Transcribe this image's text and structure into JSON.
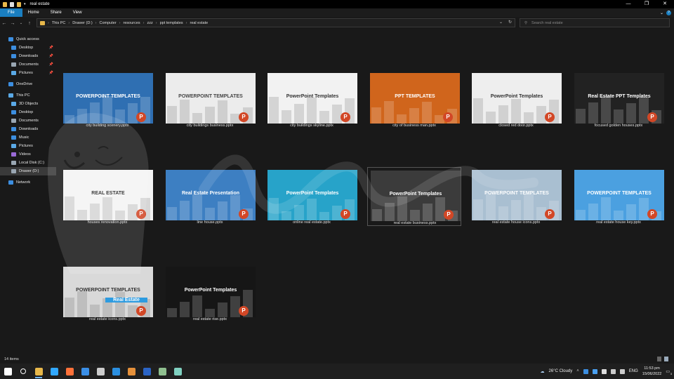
{
  "window": {
    "title": "real estate",
    "controls": [
      "—",
      "❐",
      "✕"
    ]
  },
  "ribbon": {
    "tabs": [
      "File",
      "Home",
      "Share",
      "View"
    ]
  },
  "address": {
    "crumbs": [
      "This PC",
      "Drawer (D:)",
      "Computer",
      "resources",
      "zzz",
      "ppt templates",
      "real estate"
    ],
    "search_placeholder": "Search real estate"
  },
  "sidebar": {
    "items": [
      {
        "label": "Quick access",
        "icon": "star-icon",
        "color": "#3c8ee0",
        "sub": false
      },
      {
        "label": "Desktop",
        "icon": "desktop-icon",
        "color": "#3c8ee0",
        "sub": true,
        "pinned": true
      },
      {
        "label": "Downloads",
        "icon": "download-icon",
        "color": "#3c8ee0",
        "sub": true,
        "pinned": true
      },
      {
        "label": "Documents",
        "icon": "documents-icon",
        "color": "#9aa7b3",
        "sub": true,
        "pinned": true
      },
      {
        "label": "Pictures",
        "icon": "pictures-icon",
        "color": "#5aa9e6",
        "sub": true,
        "pinned": true
      },
      {
        "label": "OneDrive",
        "icon": "cloud-icon",
        "color": "#3c8ee0",
        "sub": false,
        "gap": true
      },
      {
        "label": "This PC",
        "icon": "computer-icon",
        "color": "#5aa9e6",
        "sub": false,
        "gap": true
      },
      {
        "label": "3D Objects",
        "icon": "cube-icon",
        "color": "#5aa9e6",
        "sub": true
      },
      {
        "label": "Desktop",
        "icon": "desktop-icon",
        "color": "#3c8ee0",
        "sub": true
      },
      {
        "label": "Documents",
        "icon": "documents-icon",
        "color": "#9aa7b3",
        "sub": true
      },
      {
        "label": "Downloads",
        "icon": "download-icon",
        "color": "#3c8ee0",
        "sub": true
      },
      {
        "label": "Music",
        "icon": "music-icon",
        "color": "#3c8ee0",
        "sub": true
      },
      {
        "label": "Pictures",
        "icon": "pictures-icon",
        "color": "#5aa9e6",
        "sub": true
      },
      {
        "label": "Videos",
        "icon": "videos-icon",
        "color": "#9a6ad6",
        "sub": true
      },
      {
        "label": "Local Disk (C:)",
        "icon": "drive-icon",
        "color": "#9aa7b3",
        "sub": true
      },
      {
        "label": "Drawer (D:)",
        "icon": "drive-icon",
        "color": "#9aa7b3",
        "sub": true,
        "selected": true
      },
      {
        "label": "Network",
        "icon": "network-icon",
        "color": "#3c8ee0",
        "sub": false,
        "gap": true
      }
    ]
  },
  "files": [
    {
      "name": "city building scenery.pptx",
      "bg": "#2f6fb2",
      "accent": "#ffffff",
      "label": "POWERPOINT TEMPLATES"
    },
    {
      "name": "city buildings business.pptx",
      "bg": "#ececec",
      "accent": "#444444",
      "label": "POWERPOINT TEMPLATES"
    },
    {
      "name": "city buildings skyline.pptx",
      "bg": "#f2f2f2",
      "accent": "#333333",
      "label": "PowerPoint Templates"
    },
    {
      "name": "city of business man.pptx",
      "bg": "#d0651c",
      "accent": "#ffffff",
      "label": "PPT TEMPLATES"
    },
    {
      "name": "closed red door.pptx",
      "bg": "#eeeeee",
      "accent": "#333333",
      "label": "PowerPoint Templates"
    },
    {
      "name": "focused golden houses.pptx",
      "bg": "#222222",
      "accent": "#ffffff",
      "label": "Real Estate PPT Templates"
    },
    {
      "name": "houses renovation.pptx",
      "bg": "#f4f4f4",
      "accent": "#222222",
      "label": "REAL ESTATE"
    },
    {
      "name": "line house.pptx",
      "bg": "#3d7fc2",
      "accent": "#ffffff",
      "label": "Real Estate Presentation"
    },
    {
      "name": "online real estate.pptx",
      "bg": "#27a3c9",
      "accent": "#ffffff",
      "label": "PowerPoint Templates"
    },
    {
      "name": "real estate business.pptx",
      "bg": "#3b3b3b",
      "accent": "#ffffff",
      "label": "PowerPoint Templates",
      "selected": true
    },
    {
      "name": "real estate house icons.pptx",
      "bg": "#a9bfd1",
      "accent": "#ffffff",
      "label": "POWERPOINT TEMPLATES"
    },
    {
      "name": "real estate house key.pptx",
      "bg": "#4ba0e0",
      "accent": "#ffffff",
      "label": "POWERPOINT TEMPLATES"
    },
    {
      "name": "real estate icons.pptx",
      "bg": "#d9d9d9",
      "accent": "#333333",
      "label": "POWERPOINT TEMPLATES",
      "label2": "Real Estate"
    },
    {
      "name": "real estate rise.pptx",
      "bg": "#161616",
      "accent": "#ffffff",
      "label": "PowerPoint Templates"
    }
  ],
  "status": {
    "count": "14 items"
  },
  "taskbar": {
    "apps": [
      {
        "icon": "windows-icon",
        "color": "#ffffff"
      },
      {
        "icon": "search-icon",
        "color": "#ffffff"
      },
      {
        "icon": "explorer-icon",
        "color": "#e8b84a",
        "active": true
      },
      {
        "icon": "photoshop-icon",
        "color": "#31a8ff"
      },
      {
        "icon": "firefox-icon",
        "color": "#ff7139"
      },
      {
        "icon": "thunderbird-icon",
        "color": "#3a8ee6"
      },
      {
        "icon": "terminal-icon",
        "color": "#cccccc"
      },
      {
        "icon": "vscode-icon",
        "color": "#2b8fe0"
      },
      {
        "icon": "archive-icon",
        "color": "#e5903a"
      },
      {
        "icon": "word-icon",
        "color": "#2b64c5"
      },
      {
        "icon": "app-icon",
        "color": "#8fbf8f"
      },
      {
        "icon": "notes-icon",
        "color": "#7fd0c0"
      }
    ],
    "weather": "26°C  Cloudy",
    "lang": "ENG",
    "time": "11:53 pm",
    "date": "15/06/2022",
    "notif_count": "3"
  }
}
